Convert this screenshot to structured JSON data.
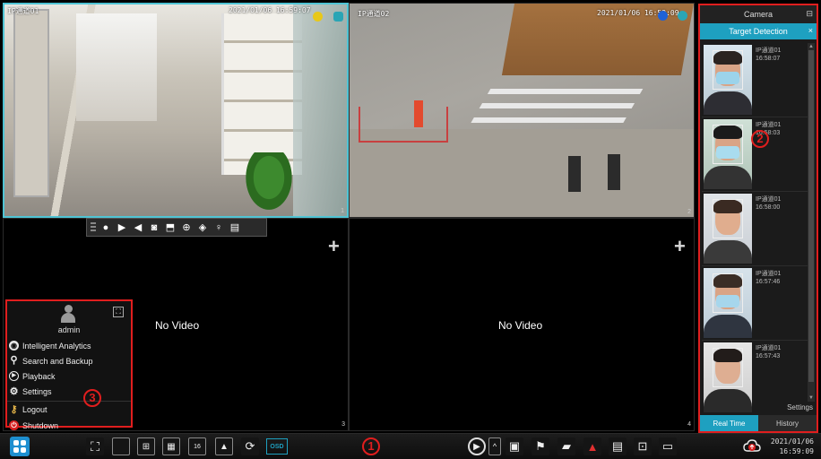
{
  "tiles": [
    {
      "channel_label": "IP通道01",
      "timestamp": "2021/01/06 16:59:07",
      "number": "1"
    },
    {
      "channel_label": "IP通道02",
      "timestamp": "2021/01/06 16:59:09",
      "number": "2"
    },
    {
      "no_video_label": "No Video",
      "number": "3"
    },
    {
      "no_video_label": "No Video",
      "number": "4"
    }
  ],
  "start_menu": {
    "username": "admin",
    "items": [
      {
        "label": "Intelligent Analytics",
        "icon": "analytics-icon"
      },
      {
        "label": "Search and Backup",
        "icon": "search-icon"
      },
      {
        "label": "Playback",
        "icon": "playback-icon"
      },
      {
        "label": "Settings",
        "icon": "gear-icon"
      },
      {
        "label": "Logout",
        "icon": "key-icon"
      },
      {
        "label": "Shutdown",
        "icon": "power-icon"
      }
    ]
  },
  "side_panel": {
    "title": "Camera",
    "tab": "Target Detection",
    "detections": [
      {
        "channel": "IP通道01",
        "time": "16:58:07",
        "masked": true
      },
      {
        "channel": "IP通道01",
        "time": "16:58:03",
        "masked": true
      },
      {
        "channel": "IP通道01",
        "time": "16:58:00",
        "masked": false
      },
      {
        "channel": "IP通道01",
        "time": "16:57:46",
        "masked": true
      },
      {
        "channel": "IP通道01",
        "time": "16:57:43",
        "masked": false
      }
    ],
    "settings_label": "Settings",
    "bottom_tabs": [
      "Real Time",
      "History"
    ]
  },
  "taskbar": {
    "osd_label": "OSD",
    "date": "2021/01/06",
    "time": "16:59:09"
  },
  "callouts": [
    "1",
    "2",
    "3"
  ],
  "colors": {
    "accent": "#1ea0c0",
    "callout": "#e01e1e",
    "selected_border": "#4fc4d4"
  }
}
